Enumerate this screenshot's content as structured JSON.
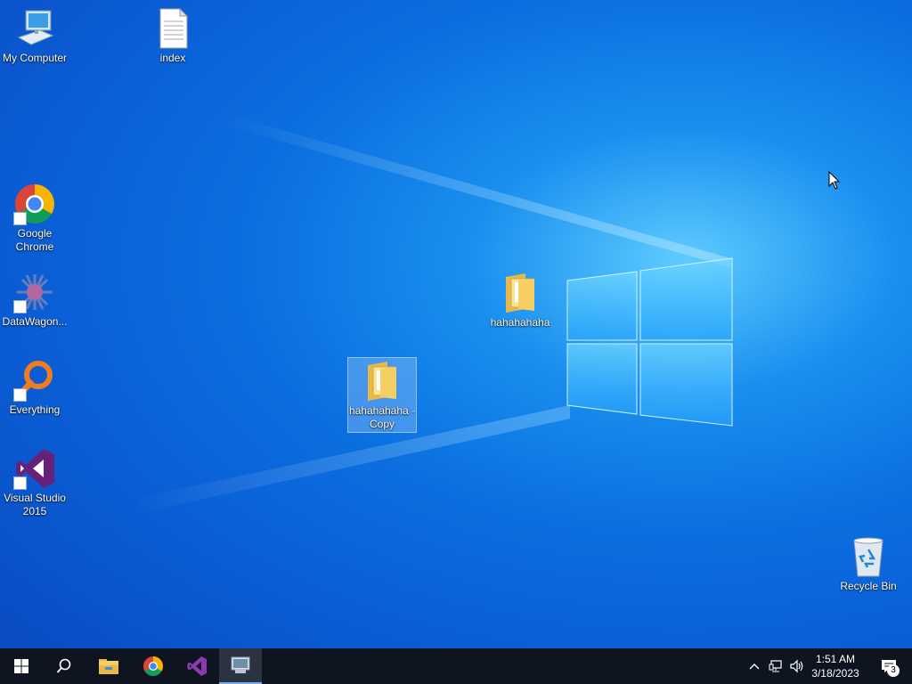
{
  "desktop": {
    "icons": [
      {
        "label": "My Computer"
      },
      {
        "label": "index"
      },
      {
        "label": "Google Chrome"
      },
      {
        "label": "DataWagon..."
      },
      {
        "label": "Everything"
      },
      {
        "label": "Visual Studio 2015"
      },
      {
        "label": "hahahahaha"
      },
      {
        "label": "hahahahaha - Copy"
      },
      {
        "label": "Recycle Bin"
      }
    ]
  },
  "taskbar": {
    "time": "1:51 AM",
    "date": "3/18/2023",
    "notification_count": "3",
    "pinned": [
      "start-icon",
      "search-icon",
      "file-explorer-icon",
      "chrome-icon",
      "visual-studio-icon",
      "remote-app-icon"
    ]
  },
  "colors": {
    "desktop_accent": "#0b6fe0",
    "taskbar_bg": "#0e1420"
  }
}
